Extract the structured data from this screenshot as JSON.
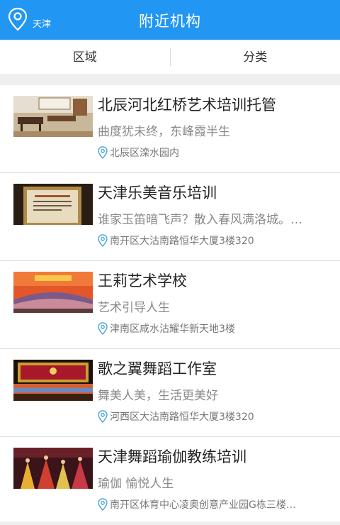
{
  "header": {
    "location": "天津",
    "title": "附近机构",
    "icon": "location-pin-icon"
  },
  "filters": [
    {
      "label": "区域"
    },
    {
      "label": "分类"
    }
  ],
  "items": [
    {
      "name": "北辰河北红桥艺术培训托管",
      "desc": "曲度犹未终，东峰霞半生",
      "address": "北辰区滦水园内"
    },
    {
      "name": "天津乐美音乐培训",
      "desc": "谁家玉笛暗飞声？散入春风满洛城。…",
      "address": "南开区大沽南路恒华大厦3楼320"
    },
    {
      "name": "王莉艺术学校",
      "desc": "艺术引导人生",
      "address": "津南区咸水沽耀华新天地3楼"
    },
    {
      "name": "歌之翼舞蹈工作室",
      "desc": "舞美人美，生活更美好",
      "address": "河西区大沽南路恒华大厦3楼320"
    },
    {
      "name": "天津舞蹈瑜伽教练培训",
      "desc": "瑜伽 愉悦人生",
      "address": "南开区体育中心凌奥创意产业园G栋三楼…"
    }
  ],
  "colors": {
    "primary": "#2196f3",
    "pin": "#4aa3e0"
  }
}
